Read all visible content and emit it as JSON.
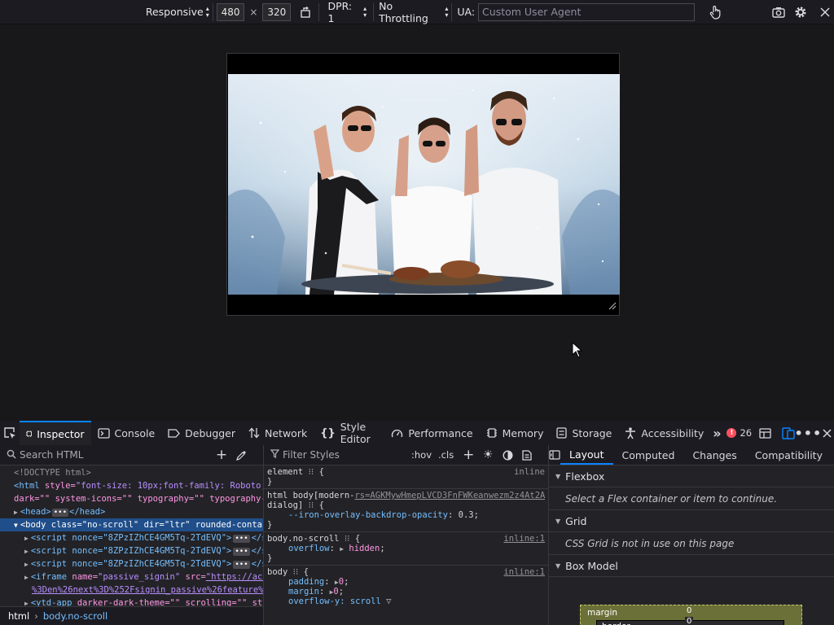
{
  "rdm": {
    "device": "Responsive",
    "width": "480",
    "height": "320",
    "times": "×",
    "dpr": "DPR: 1",
    "throttling": "No Throttling",
    "ua_label": "UA:",
    "ua_placeholder": "Custom User Agent"
  },
  "tabs": [
    "Inspector",
    "Console",
    "Debugger",
    "Network",
    "Style Editor",
    "Performance",
    "Memory",
    "Storage",
    "Accessibility"
  ],
  "error_count": "26",
  "inspector": {
    "search_placeholder": "Search HTML",
    "lines": {
      "l0": "<!DOCTYPE html>",
      "l1a": "<html",
      "l1b": " style=",
      "l1c": "\"font-size: 10px;font-family: Roboto, A",
      "l2": "dark=\"\" system-icons=\"\" typography=\"\" typography-sp",
      "l3a": "<head>",
      "l3b": "</head>",
      "l4a": "<body",
      "l4b": " class=",
      "l4c": "\"no-scroll\"",
      "l4d": " dir=",
      "l4e": "\"ltr\"",
      "l4f": " rounded-contain",
      "script1": "<script nonce=\"8ZPzIZhCE4GM5Tq-2TdEVQ\">",
      "script2": "<script nonce=\"8ZPzIZhCE4GM5Tq-2TdEVQ\">",
      "script3": "<script nonce=\"8ZPzIZhCE4GM5Tq-2TdEVQ\">",
      "script_close": "</scri",
      "iframe_a": "<iframe",
      "iframe_b": " name=",
      "iframe_c": "\"passive_signin\"",
      "iframe_d": " src=",
      "iframe_e": "\"https://accou",
      "iframe2": "%3Den%26next%3D%252Fsignin_passive%26feature%3D",
      "ytd_a": "<ytd-app",
      "ytd_b": " darker-dark-theme=\"\" scrolling=\"\" styl"
    },
    "breadcrumb": [
      "html",
      "body.no-scroll"
    ]
  },
  "rules": {
    "filter_placeholder": "Filter Styles",
    "hov": ":hov",
    "cls": ".cls",
    "r1_selector": "element",
    "r1_src": "inline",
    "r2_selector": "html body[modern-",
    "r2_src": "rs=AGKMywHmepLVCD3FnFWKeanwezm2z4At2A:1",
    "r2_selector2": "dialog]",
    "r2_prop": "--iron-overlay-backdrop-opacity",
    "r2_val": "0.3",
    "r3_selector": "body.no-scroll",
    "r3_src": "inline:1",
    "r3_prop": "overflow",
    "r3_val": "hidden",
    "r4_selector": "body",
    "r4_src": "inline:1",
    "r4_p1": "padding",
    "r4_v1": "0",
    "r4_p2": "margin",
    "r4_v2": "0",
    "r4_p3": "overflow-y: scroll"
  },
  "layout": {
    "tabs": [
      "Layout",
      "Computed",
      "Changes",
      "Compatibility"
    ],
    "flexbox": "Flexbox",
    "flexbox_msg": "Select a Flex container or item to continue.",
    "grid": "Grid",
    "grid_msg": "CSS Grid is not in use on this page",
    "boxmodel": "Box Model",
    "margin_label": "margin",
    "margin_val": "0",
    "border_label": "border",
    "border_val": "0"
  },
  "colors": {
    "accent": "#0a84ff",
    "margin_box": "#6b7038",
    "border_box": "#2a2a2e",
    "padding_box": "#6b5fbf"
  }
}
